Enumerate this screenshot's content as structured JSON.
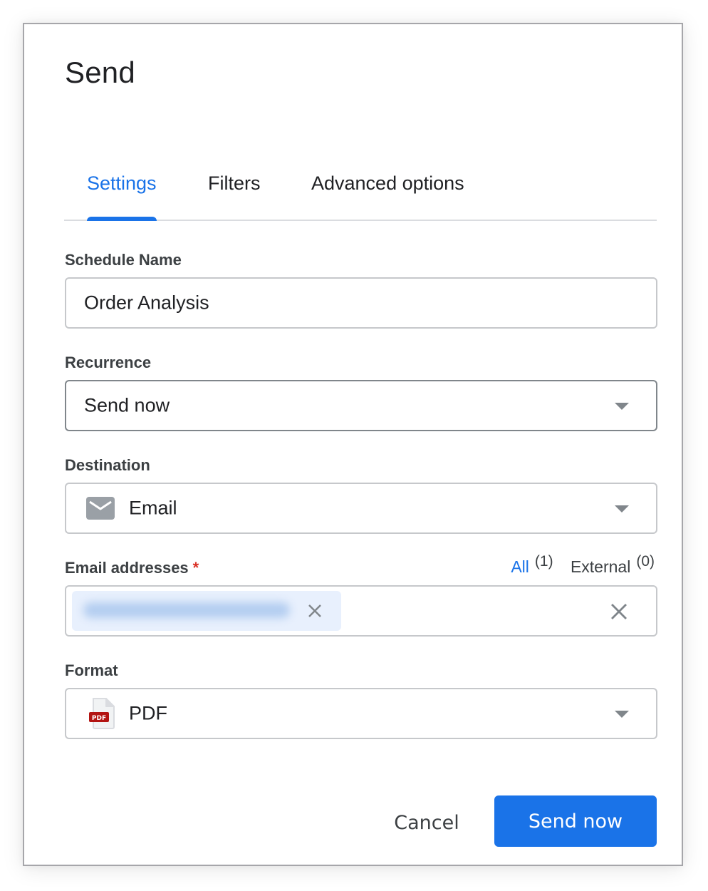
{
  "dialog": {
    "title": "Send",
    "tabs": [
      {
        "label": "Settings",
        "active": true
      },
      {
        "label": "Filters",
        "active": false
      },
      {
        "label": "Advanced options",
        "active": false
      }
    ]
  },
  "form": {
    "schedule_name": {
      "label": "Schedule Name",
      "value": "Order Analysis"
    },
    "recurrence": {
      "label": "Recurrence",
      "selected": "Send now"
    },
    "destination": {
      "label": "Destination",
      "icon": "mail-icon",
      "selected": "Email"
    },
    "email_addresses": {
      "label": "Email addresses",
      "required_marker": "*",
      "filter_all_label": "All",
      "filter_all_count": "(1)",
      "filter_external_label": "External",
      "filter_external_count": "(0)",
      "chips": [
        {
          "value": "[redacted email address]",
          "blurred": true
        }
      ]
    },
    "format": {
      "label": "Format",
      "icon": "pdf-file-icon",
      "icon_badge": "PDF",
      "selected": "PDF"
    }
  },
  "actions": {
    "cancel_label": "Cancel",
    "submit_label": "Send now"
  },
  "colors": {
    "accent": "#1a73e8",
    "required": "#d93025",
    "text": "#202124",
    "chip_bg": "#e8f0fd"
  }
}
